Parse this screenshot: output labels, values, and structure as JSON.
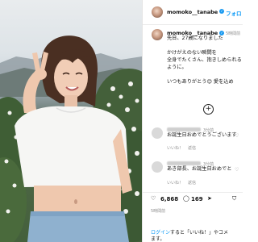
{
  "post": {
    "header_username": "momoko__tanabe",
    "follow_label": "フォロ",
    "caption_username": "momoko__tanabe",
    "caption_time": "5時間前",
    "caption_lines": [
      "先日、27歳になりました",
      "かけがえのない瞬間を",
      "全身でたくさん、抱きしめられる",
      "ように。",
      "いつもありがとう😊 愛を込め"
    ],
    "more_icon": "plus-circle-icon"
  },
  "comments": [
    {
      "time": "3分前",
      "text": "お誕生日おめでとうございます",
      "like_label": "いいね！",
      "reply_label": "返信"
    },
    {
      "time": "3分前",
      "text": "あき部長、お誕生日おめでと",
      "like_label": "いいね！",
      "reply_label": "返信"
    }
  ],
  "actions": {
    "likes": "6,868",
    "comments": "169",
    "time": "5時間前"
  },
  "login": {
    "login_link": "ログイン",
    "text_after": "すると「いいね！」やコメ",
    "text_line2": "ます。"
  },
  "colors": {
    "link": "#0095f6",
    "verified": "#1d9bf0",
    "muted": "#8e8e8e"
  },
  "icons": [
    "heart-icon",
    "comment-icon",
    "share-icon",
    "bookmark-icon",
    "verified-icon"
  ]
}
